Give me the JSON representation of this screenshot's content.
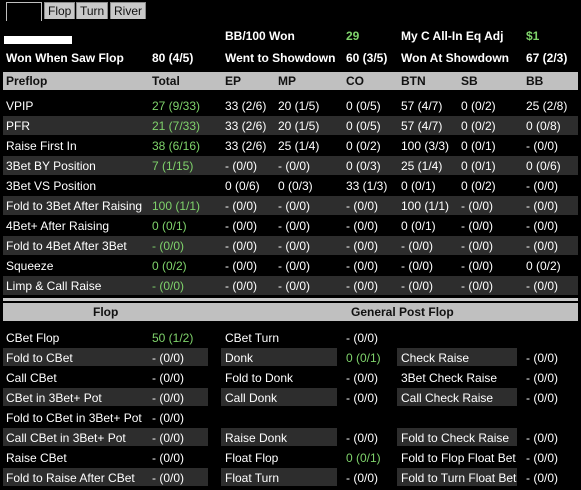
{
  "tabs": [
    "",
    "Flop",
    "Turn",
    "River"
  ],
  "summary": {
    "row1": [
      {
        "label": "BB/100 Won",
        "value": "29",
        "value_green": true
      },
      {
        "label": "My C All-In Eq Adj",
        "value": "$1",
        "value_green": true
      }
    ],
    "row2": [
      {
        "label": "Won When Saw Flop",
        "value": "80 (4/5)"
      },
      {
        "label": "Went to Showdown",
        "value": "60 (3/5)"
      },
      {
        "label": "Won At Showdown",
        "value": "67 (2/3)"
      }
    ]
  },
  "preflop": {
    "headers": [
      "Preflop",
      "Total",
      "EP",
      "MP",
      "CO",
      "BTN",
      "SB",
      "BB"
    ],
    "rows": [
      {
        "label": "VPIP",
        "cells": [
          "27 (9/33)",
          "33 (2/6)",
          "20 (1/5)",
          "0 (0/5)",
          "57 (4/7)",
          "0 (0/2)",
          "25 (2/8)"
        ]
      },
      {
        "label": "PFR",
        "cells": [
          "21 (7/33)",
          "33 (2/6)",
          "20 (1/5)",
          "0 (0/5)",
          "57 (4/7)",
          "0 (0/2)",
          "0 (0/8)"
        ]
      },
      {
        "label": "Raise First In",
        "cells": [
          "38 (6/16)",
          "33 (2/6)",
          "25 (1/4)",
          "0 (0/2)",
          "100 (3/3)",
          "0 (0/1)",
          "- (0/0)"
        ]
      },
      {
        "label": "3Bet BY Position",
        "cells": [
          "7 (1/15)",
          "- (0/0)",
          "- (0/0)",
          "0 (0/3)",
          "25 (1/4)",
          "0 (0/1)",
          "0 (0/6)"
        ]
      },
      {
        "label": "3Bet VS Position",
        "cells": [
          "",
          "0 (0/6)",
          "0 (0/3)",
          "33 (1/3)",
          "0 (0/1)",
          "0 (0/2)",
          "- (0/0)"
        ]
      },
      {
        "label": "Fold to 3Bet After Raising",
        "cells": [
          "100 (1/1)",
          "- (0/0)",
          "- (0/0)",
          "- (0/0)",
          "100 (1/1)",
          "- (0/0)",
          "- (0/0)"
        ]
      },
      {
        "label": "4Bet+ After Raising",
        "cells": [
          "0 (0/1)",
          "- (0/0)",
          "- (0/0)",
          "- (0/0)",
          "0 (0/1)",
          "- (0/0)",
          "- (0/0)"
        ]
      },
      {
        "label": "Fold to 4Bet After 3Bet",
        "cells": [
          "- (0/0)",
          "- (0/0)",
          "- (0/0)",
          "- (0/0)",
          "- (0/0)",
          "- (0/0)",
          "- (0/0)"
        ]
      },
      {
        "label": "Squeeze",
        "cells": [
          "0 (0/2)",
          "- (0/0)",
          "- (0/0)",
          "- (0/0)",
          "- (0/0)",
          "- (0/0)",
          "0 (0/2)"
        ]
      },
      {
        "label": "Limp & Call Raise",
        "cells": [
          "- (0/0)",
          "- (0/0)",
          "- (0/0)",
          "- (0/0)",
          "- (0/0)",
          "- (0/0)",
          "- (0/0)"
        ]
      }
    ]
  },
  "postflop": {
    "flop_header": "Flop",
    "general_header": "General Post Flop",
    "col1": [
      {
        "label": "CBet Flop",
        "value": "50 (1/2)"
      },
      {
        "label": "Fold to CBet",
        "value": "- (0/0)"
      },
      {
        "label": "Call CBet",
        "value": "- (0/0)"
      },
      {
        "label": "CBet in 3Bet+ Pot",
        "value": "- (0/0)"
      },
      {
        "label": "Fold to CBet in 3Bet+ Pot",
        "value": "- (0/0)"
      },
      {
        "label": "Call CBet in 3Bet+ Pot",
        "value": "- (0/0)"
      },
      {
        "label": "Raise CBet",
        "value": "- (0/0)"
      },
      {
        "label": "Fold to Raise After CBet",
        "value": "- (0/0)"
      }
    ],
    "col2": [
      {
        "label": "CBet Turn",
        "value": "- (0/0)"
      },
      {
        "label": "Donk",
        "value": "0 (0/1)"
      },
      {
        "label": "Fold to Donk",
        "value": "- (0/0)"
      },
      {
        "label": "Call Donk",
        "value": "- (0/0)"
      },
      {
        "label": "",
        "value": ""
      },
      {
        "label": "Raise Donk",
        "value": "- (0/0)"
      },
      {
        "label": "Float Flop",
        "value": "0 (0/1)"
      },
      {
        "label": "Float Turn",
        "value": "- (0/0)"
      }
    ],
    "col3": [
      {
        "label": "",
        "value": ""
      },
      {
        "label": "Check Raise",
        "value": "- (0/0)"
      },
      {
        "label": "3Bet Check Raise",
        "value": "- (0/0)"
      },
      {
        "label": "Call Check Raise",
        "value": "- (0/0)"
      },
      {
        "label": "",
        "value": ""
      },
      {
        "label": "Fold to Check Raise",
        "value": "- (0/0)"
      },
      {
        "label": "Fold to Flop Float Bet",
        "value": "- (0/0)"
      },
      {
        "label": "Fold to Turn Float Bet",
        "value": "- (0/0)"
      }
    ]
  },
  "colors": {
    "accent_green": "#7fd36b",
    "header_bar": "#c0c0c0",
    "row_shade": "#2d2d2d"
  }
}
